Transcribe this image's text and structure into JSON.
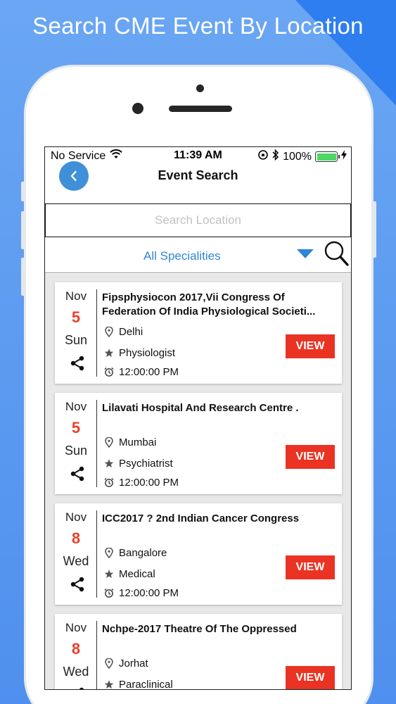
{
  "headline": "Search CME Event By Location",
  "status_bar": {
    "carrier": "No Service",
    "time": "11:39 AM",
    "battery": "100%"
  },
  "nav": {
    "title": "Event Search"
  },
  "search": {
    "placeholder": "Search Location"
  },
  "filter": {
    "selected": "All Specialities"
  },
  "events": [
    {
      "month": "Nov",
      "day": "5",
      "weekday": "Sun",
      "title": "Fipsphysiocon 2017,Vii Congress Of Federation Of India Physiological Societi...",
      "location": "Delhi",
      "speciality": "Physiologist",
      "time": "12:00:00 PM",
      "view_label": "VIEW"
    },
    {
      "month": "Nov",
      "day": "5",
      "weekday": "Sun",
      "title": "Lilavati Hospital And Research Centre .",
      "location": "Mumbai",
      "speciality": "Psychiatrist",
      "time": "12:00:00 PM",
      "view_label": "VIEW"
    },
    {
      "month": "Nov",
      "day": "8",
      "weekday": "Wed",
      "title": "ICC2017 ? 2nd Indian Cancer Congress",
      "location": "Bangalore",
      "speciality": "Medical",
      "time": "12:00:00 PM",
      "view_label": "VIEW"
    },
    {
      "month": "Nov",
      "day": "8",
      "weekday": "Wed",
      "title": "Nchpe-2017 Theatre Of The Oppressed",
      "location": "Jorhat",
      "speciality": "Paraclinical",
      "time": "",
      "view_label": "VIEW"
    }
  ],
  "colors": {
    "accent_blue": "#2f86d6",
    "date_red": "#e8412c",
    "view_button": "#ea3323"
  }
}
